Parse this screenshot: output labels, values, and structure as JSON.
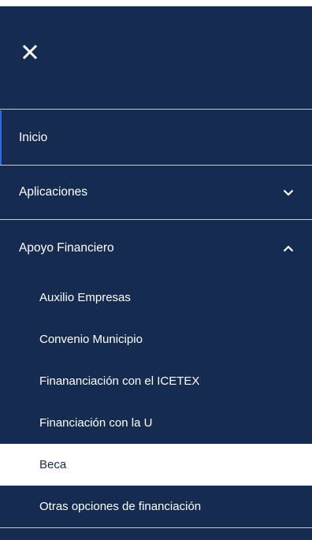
{
  "menu": {
    "close_icon": "close-icon",
    "items": [
      {
        "label": "Inicio"
      },
      {
        "label": "Aplicaciones",
        "expanded": false,
        "icon": "chevron-down-icon"
      },
      {
        "label": "Apoyo Financiero",
        "expanded": true,
        "icon": "chevron-up-icon"
      }
    ],
    "subitems": [
      {
        "label": "Auxilio Empresas"
      },
      {
        "label": "Convenio Municipio"
      },
      {
        "label": "Finananciación con el ICETEX"
      },
      {
        "label": "Financiación con la U"
      },
      {
        "label": "Beca",
        "selected": true
      },
      {
        "label": "Otras opciones de financiación"
      }
    ]
  },
  "colors": {
    "background": "#152b4f",
    "text": "#ffffff",
    "selected_background": "#ffffff",
    "selected_text": "#152b4f",
    "active_indicator": "#2f6cd8",
    "divider": "#c3cbd8"
  }
}
